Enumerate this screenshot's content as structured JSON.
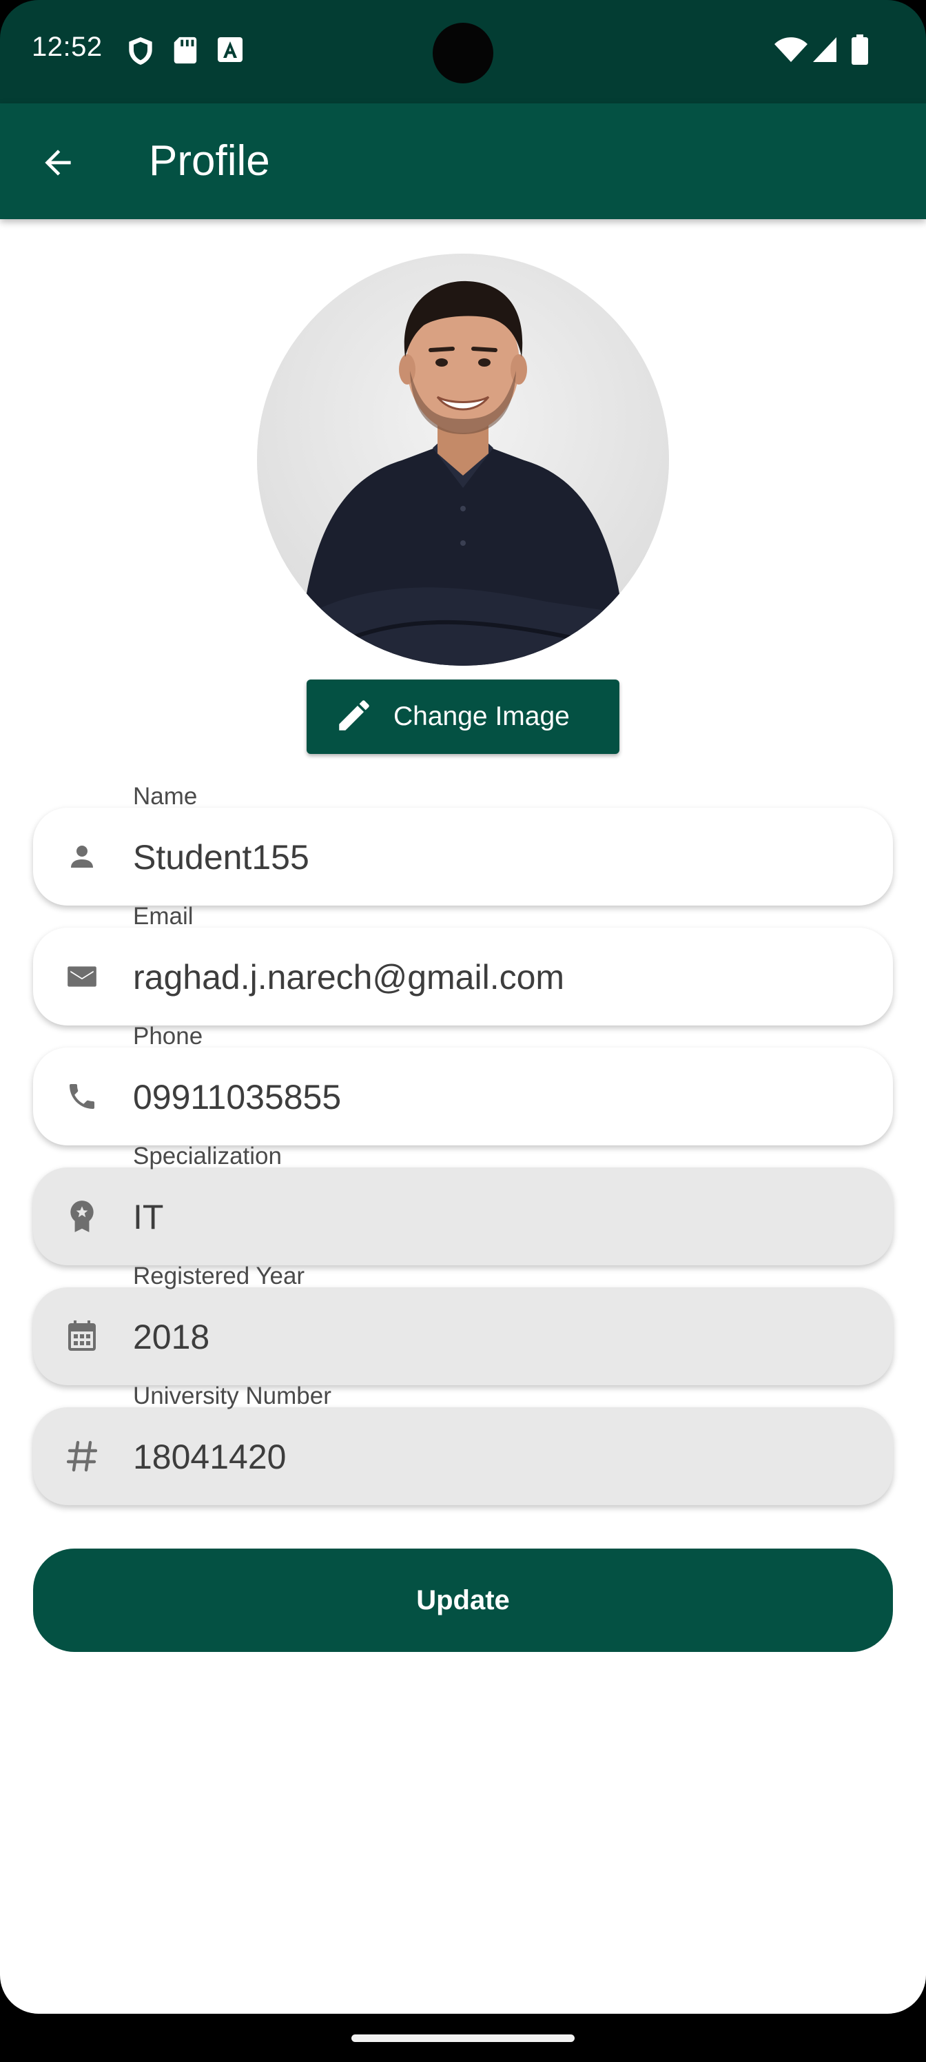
{
  "status_bar": {
    "time": "12:52",
    "left_icons": [
      "shield-icon",
      "sd-card-icon",
      "a-box-icon"
    ],
    "right_icons": [
      "wifi-icon",
      "signal-icon",
      "battery-icon"
    ]
  },
  "app_bar": {
    "back_icon": "arrow-left-icon",
    "title": "Profile"
  },
  "profile": {
    "avatar": "profile-photo",
    "change_image_icon": "pencil-icon",
    "change_image_label": "Change Image"
  },
  "fields": [
    {
      "label": "Name",
      "value": "Student155",
      "icon": "person-icon",
      "editable": true
    },
    {
      "label": "Email",
      "value": "raghad.j.narech@gmail.com",
      "icon": "mail-icon",
      "editable": true
    },
    {
      "label": "Phone",
      "value": "09911035855",
      "icon": "phone-icon",
      "editable": true
    },
    {
      "label": "Specialization",
      "value": "IT",
      "icon": "badge-icon",
      "editable": false
    },
    {
      "label": "Registered Year",
      "value": "2018",
      "icon": "calendar-icon",
      "editable": false
    },
    {
      "label": "University Number",
      "value": "18041420",
      "icon": "hash-icon",
      "editable": false
    }
  ],
  "update_label": "Update",
  "colors": {
    "primary": "#045143",
    "status_bar": "#033d33",
    "readonly_field": "#e8e8e8",
    "field_text": "#3d3d3d",
    "label_text": "#4a4a4a"
  }
}
